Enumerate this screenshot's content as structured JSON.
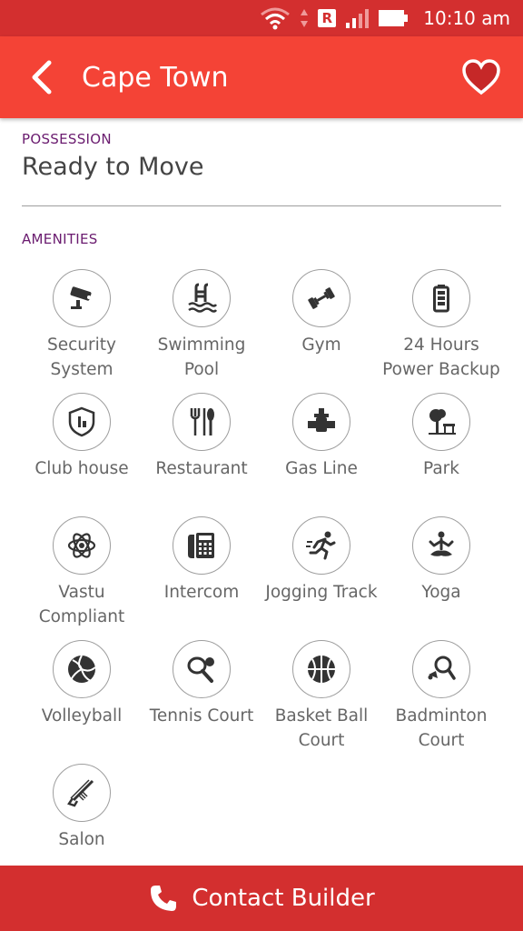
{
  "status_bar": {
    "time": "10:10 am",
    "roaming_badge": "R"
  },
  "header": {
    "title": "Cape Town",
    "color": "#f44336"
  },
  "possession": {
    "label": "POSSESSION",
    "value": "Ready to Move"
  },
  "amenities": {
    "label": "AMENITIES",
    "items": [
      {
        "label": "Security\nSystem",
        "icon": "cctv-icon"
      },
      {
        "label": "Swimming\nPool",
        "icon": "swimming-pool-icon"
      },
      {
        "label": "Gym",
        "icon": "dumbbell-icon"
      },
      {
        "label": "24 Hours\nPower Backup",
        "icon": "battery-icon"
      },
      {
        "label": "Club house",
        "icon": "club-house-icon"
      },
      {
        "label": "Restaurant",
        "icon": "fork-knife-icon"
      },
      {
        "label": "Gas Line",
        "icon": "gas-line-icon"
      },
      {
        "label": "Park",
        "icon": "park-icon"
      },
      {
        "label": "Vastu\nCompliant",
        "icon": "atom-icon"
      },
      {
        "label": "Intercom",
        "icon": "intercom-phone-icon"
      },
      {
        "label": "Jogging Track",
        "icon": "runner-icon"
      },
      {
        "label": "Yoga",
        "icon": "yoga-icon"
      },
      {
        "label": "Volleyball",
        "icon": "volleyball-icon"
      },
      {
        "label": "Tennis Court",
        "icon": "tennis-icon"
      },
      {
        "label": "Basket Ball\nCourt",
        "icon": "basketball-icon"
      },
      {
        "label": "Badminton\nCourt",
        "icon": "badminton-icon"
      },
      {
        "label": "Salon",
        "icon": "salon-icon"
      }
    ]
  },
  "footer": {
    "contact_label": "Contact Builder",
    "color": "#d32f2f"
  }
}
